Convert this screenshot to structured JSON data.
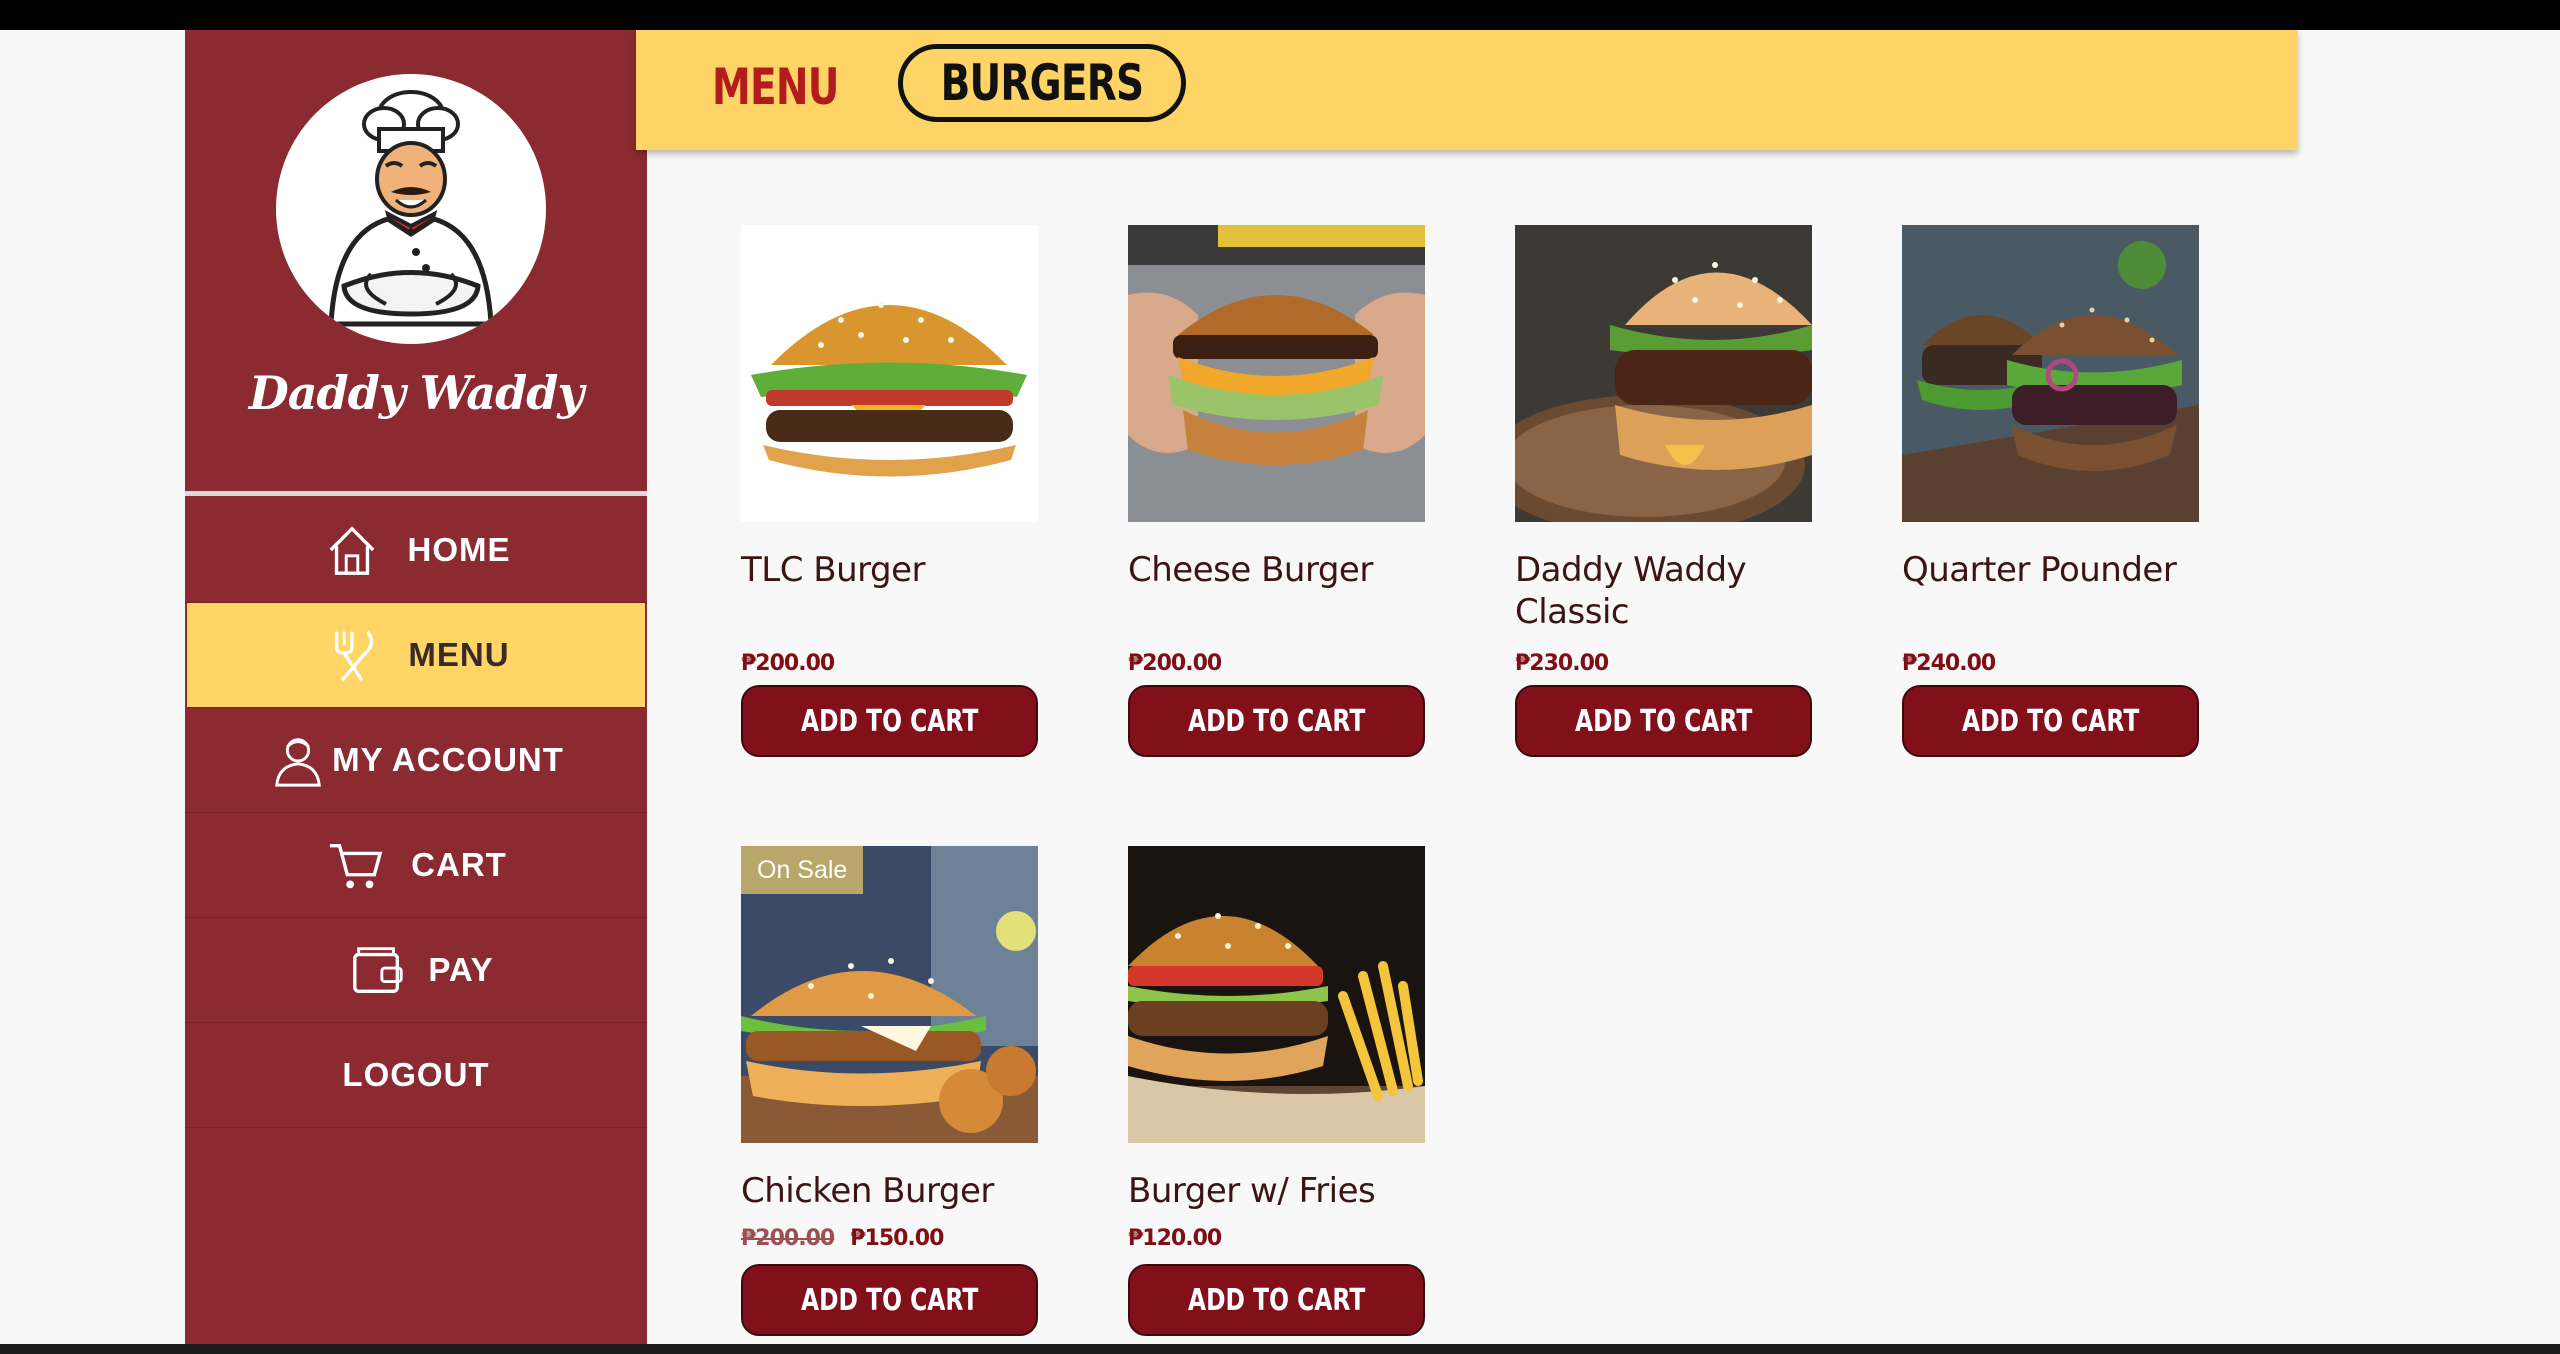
{
  "brand": {
    "name": "Daddy Waddy"
  },
  "nav": {
    "items": [
      {
        "label": "HOME",
        "icon": "home-icon",
        "active": false
      },
      {
        "label": "MENU",
        "icon": "utensils-icon",
        "active": true
      },
      {
        "label": "MY ACCOUNT",
        "icon": "user-icon",
        "active": false
      },
      {
        "label": "CART",
        "icon": "cart-icon",
        "active": false
      },
      {
        "label": "PAY",
        "icon": "wallet-icon",
        "active": false
      },
      {
        "label": "LOGOUT",
        "icon": "",
        "active": false
      }
    ]
  },
  "header": {
    "title": "MENU",
    "category": "BURGERS"
  },
  "colors": {
    "sidebar": "#8b2a31",
    "header": "#ffd466",
    "active_nav": "#ffd666",
    "button": "#82101b",
    "sale_badge": "#b9a66a"
  },
  "products": [
    {
      "name": "TLC Burger",
      "price": "₱200.00",
      "old_price": "",
      "badge": "",
      "button": "ADD TO CART"
    },
    {
      "name": "Cheese Burger",
      "price": "₱200.00",
      "old_price": "",
      "badge": "",
      "button": "ADD TO CART"
    },
    {
      "name": "Daddy Waddy Classic",
      "price": "₱230.00",
      "old_price": "",
      "badge": "",
      "button": "ADD TO CART"
    },
    {
      "name": "Quarter Pounder",
      "price": "₱240.00",
      "old_price": "",
      "badge": "",
      "button": "ADD TO CART"
    },
    {
      "name": "Chicken Burger",
      "price": "₱150.00",
      "old_price": "₱200.00",
      "badge": "On Sale",
      "button": "ADD TO CART"
    },
    {
      "name": "Burger w/ Fries",
      "price": "₱120.00",
      "old_price": "",
      "badge": "",
      "button": "ADD TO CART"
    }
  ]
}
